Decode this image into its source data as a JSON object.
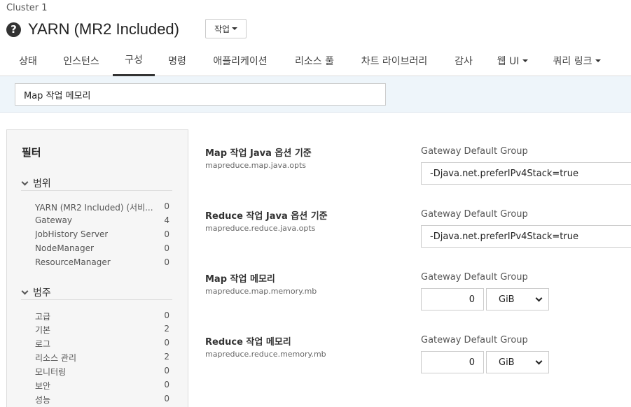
{
  "header": {
    "cluster": "Cluster 1",
    "title": "YARN (MR2 Included)",
    "actions_label": "작업"
  },
  "tabs": [
    {
      "label": "상태"
    },
    {
      "label": "인스턴스"
    },
    {
      "label": "구성",
      "active": true
    },
    {
      "label": "명령"
    },
    {
      "label": "애플리케이션"
    },
    {
      "label": "리소스 풀"
    },
    {
      "label": "차트 라이브러리"
    },
    {
      "label": "감사"
    },
    {
      "label": "웹 UI",
      "dropdown": true
    },
    {
      "label": "쿼리 링크",
      "dropdown": true
    }
  ],
  "search": {
    "value": "Map 작업 메모리"
  },
  "filters": {
    "title": "필터",
    "scope": {
      "label": "범위",
      "items": [
        {
          "label": "YARN (MR2 Included) (서비...",
          "count": "0"
        },
        {
          "label": "Gateway",
          "count": "4"
        },
        {
          "label": "JobHistory Server",
          "count": "0"
        },
        {
          "label": "NodeManager",
          "count": "0"
        },
        {
          "label": "ResourceManager",
          "count": "0"
        }
      ]
    },
    "category": {
      "label": "범주",
      "items": [
        {
          "label": "고급",
          "count": "0"
        },
        {
          "label": "기본",
          "count": "2"
        },
        {
          "label": "로그",
          "count": "0"
        },
        {
          "label": "리소스 관리",
          "count": "2"
        },
        {
          "label": "모니터링",
          "count": "0"
        },
        {
          "label": "보안",
          "count": "0"
        },
        {
          "label": "성능",
          "count": "0"
        }
      ]
    }
  },
  "properties": [
    {
      "name": "Map 작업 Java 옵션 기준",
      "key": "mapreduce.map.java.opts",
      "scope": "Gateway Default Group",
      "value": "-Djava.net.preferIPv4Stack=true"
    },
    {
      "name": "Reduce 작업 Java 옵션 기준",
      "key": "mapreduce.reduce.java.opts",
      "scope": "Gateway Default Group",
      "value": "-Djava.net.preferIPv4Stack=true"
    },
    {
      "name": "Map 작업 메모리",
      "key": "mapreduce.map.memory.mb",
      "scope": "Gateway Default Group",
      "value": "0",
      "unit": "GiB"
    },
    {
      "name": "Reduce 작업 메모리",
      "key": "mapreduce.reduce.memory.mb",
      "scope": "Gateway Default Group",
      "value": "0",
      "unit": "GiB"
    }
  ]
}
